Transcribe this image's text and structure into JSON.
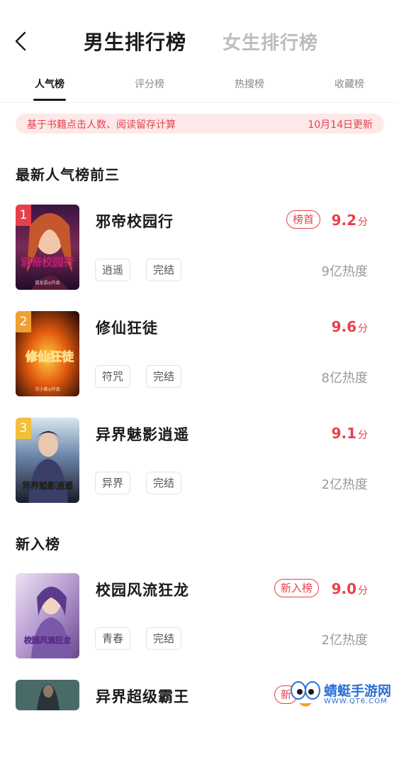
{
  "header": {
    "title_active": "男生排行榜",
    "title_inactive": "女生排行榜"
  },
  "tabs": [
    {
      "label": "人气榜",
      "active": true
    },
    {
      "label": "评分榜",
      "active": false
    },
    {
      "label": "热搜榜",
      "active": false
    },
    {
      "label": "收藏榜",
      "active": false
    }
  ],
  "notice": {
    "text": "基于书籍点击人数、阅读留存计算",
    "updated": "10月14日更新"
  },
  "section_top3": {
    "title": "最新人气榜前三",
    "books": [
      {
        "rank": "1",
        "title": "邪帝校园行",
        "badge": "榜首",
        "score": "9.2",
        "unit": "分",
        "tags": [
          "逍遥",
          "完结"
        ],
        "heat": "9亿热度",
        "cover_text": "邪帝校园行",
        "cover_author": "狐龙语◎作品"
      },
      {
        "rank": "2",
        "title": "修仙狂徒",
        "badge": "",
        "score": "9.6",
        "unit": "分",
        "tags": [
          "符咒",
          "完结"
        ],
        "heat": "8亿热度",
        "cover_text": "修仙狂徒",
        "cover_author": "王小蛮◎作品"
      },
      {
        "rank": "3",
        "title": "异界魅影逍遥",
        "badge": "",
        "score": "9.1",
        "unit": "分",
        "tags": [
          "异界",
          "完结"
        ],
        "heat": "2亿热度",
        "cover_text": "异界魅影逍遥",
        "cover_author": ""
      }
    ]
  },
  "section_new": {
    "title": "新入榜",
    "books": [
      {
        "title": "校园风流狂龙",
        "badge": "新入榜",
        "score": "9.0",
        "unit": "分",
        "tags": [
          "青春",
          "完结"
        ],
        "heat": "2亿热度",
        "cover_text": "校园风流狂龙"
      },
      {
        "title": "异界超级霸王",
        "badge": "新",
        "score": "",
        "unit": "",
        "tags": [],
        "heat": ""
      }
    ]
  },
  "watermark": {
    "text": "蜻蜓手游网",
    "sub": "WWW.QT6.COM"
  },
  "colors": {
    "accent": "#e8404a",
    "rank1": "#e8404a",
    "rank2": "#f0a030",
    "rank3": "#f3c03c"
  },
  "icons": {
    "back": "chevron-left-icon",
    "watermark": "dragonfly-logo-icon"
  }
}
